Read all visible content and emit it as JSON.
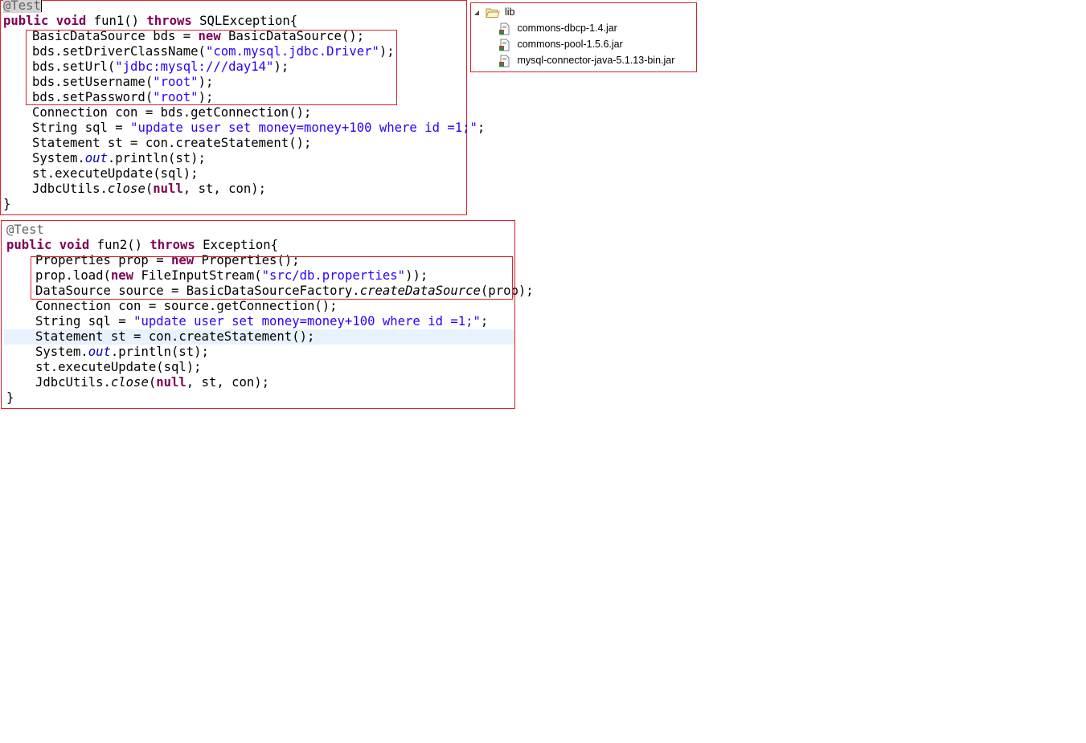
{
  "tree": {
    "folder_label": "lib",
    "files": [
      "commons-dbcp-1.4.jar",
      "commons-pool-1.5.6.jar",
      "mysql-connector-java-5.1.13-bin.jar"
    ]
  },
  "snippet1": {
    "annotation": "@Test",
    "sig_public": "public",
    "sig_void": "void",
    "sig_name": " fun1() ",
    "sig_throws": "throws",
    "sig_exc": " SQLException{",
    "l1a": "BasicDataSource bds = ",
    "l1b": "new",
    "l1c": " BasicDataSource();",
    "l2a": "bds.setDriverClassName(",
    "l2b": "\"com.mysql.jdbc.Driver\"",
    "l2c": ");",
    "l3a": "bds.setUrl(",
    "l3b": "\"jdbc:mysql:///day14\"",
    "l3c": ");",
    "l4a": "bds.setUsername(",
    "l4b": "\"root\"",
    "l4c": ");",
    "l5a": "bds.setPassword(",
    "l5b": "\"root\"",
    "l5c": ");",
    "l6": "Connection con = bds.getConnection();",
    "l7a": "String sql = ",
    "l7b": "\"update user set money=money+100 where id =1;\"",
    "l7c": ";",
    "l8": "Statement st = con.createStatement();",
    "l9a": "System.",
    "l9b": "out",
    "l9c": ".println(st);",
    "l10": "st.executeUpdate(sql);",
    "l11a": "JdbcUtils.",
    "l11b": "close",
    "l11c": "(",
    "l11d": "null",
    "l11e": ", st, con);",
    "close": "}"
  },
  "snippet2": {
    "annotation": "@Test",
    "sig_public": "public",
    "sig_void": "void",
    "sig_name": " fun2() ",
    "sig_throws": "throws",
    "sig_exc": " Exception{",
    "l1a": "Properties prop = ",
    "l1b": "new",
    "l1c": " Properties();",
    "l2a": "prop.load(",
    "l2b": "new",
    "l2c": " FileInputStream(",
    "l2d": "\"src/db.properties\"",
    "l2e": "));",
    "l3a": "DataSource source = BasicDataSourceFactory.",
    "l3b": "createDataSource",
    "l3c": "(prop);",
    "l4": "Connection con = source.getConnection();",
    "l5a": "String sql = ",
    "l5b": "\"update user set money=money+100 where id =1;\"",
    "l5c": ";",
    "l6": "Statement st = con.createStatement();",
    "l7a": "System.",
    "l7b": "out",
    "l7c": ".println(st);",
    "l8": "st.executeUpdate(sql);",
    "l9a": "JdbcUtils.",
    "l9b": "close",
    "l9c": "(",
    "l9d": "null",
    "l9e": ", st, con);",
    "close": "}"
  },
  "colors": {
    "keyword": "#7f0055",
    "string": "#2a00ff",
    "annotation": "#646464",
    "highlight_box": "#e0202a",
    "current_line": "#e8f2fe"
  }
}
